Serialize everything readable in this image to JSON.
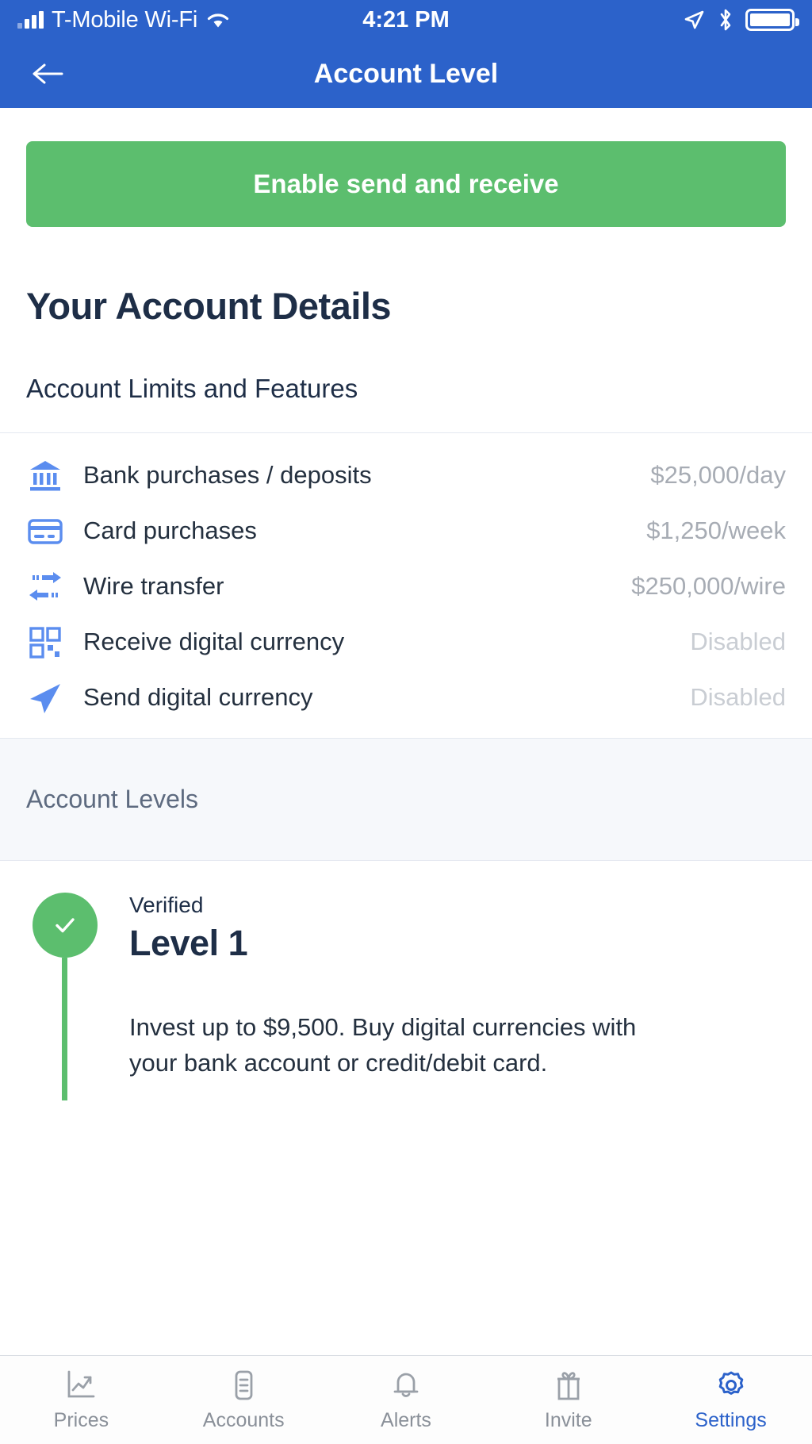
{
  "status_bar": {
    "carrier": "T-Mobile Wi-Fi",
    "time": "4:21 PM",
    "icons": [
      "signal-bars-icon",
      "wifi-icon",
      "location-arrow-icon",
      "bluetooth-icon",
      "battery-icon"
    ]
  },
  "header": {
    "title": "Account Level",
    "back_icon": "back-arrow-icon",
    "background_color": "#2C62CA"
  },
  "cta": {
    "label": "Enable send and receive",
    "color": "#5CBE6E"
  },
  "page_title": "Your Account Details",
  "limits_section": {
    "title": "Account Limits and Features",
    "rows": [
      {
        "icon": "bank-icon",
        "label": "Bank purchases / deposits",
        "value": "$25,000/day",
        "disabled": false
      },
      {
        "icon": "credit-card-icon",
        "label": "Card purchases",
        "value": "$1,250/week",
        "disabled": false
      },
      {
        "icon": "wire-transfer-icon",
        "label": "Wire transfer",
        "value": "$250,000/wire",
        "disabled": false
      },
      {
        "icon": "qr-code-icon",
        "label": "Receive digital currency",
        "value": "Disabled",
        "disabled": true
      },
      {
        "icon": "send-plane-icon",
        "label": "Send digital currency",
        "value": "Disabled",
        "disabled": true
      }
    ]
  },
  "levels_section": {
    "title": "Account Levels",
    "levels": [
      {
        "status": "Verified",
        "name": "Level 1",
        "description": "Invest up to $9,500. Buy digital currencies with your bank account or credit/debit card.",
        "marker_icon": "check-icon",
        "marker_color": "#5CBE6E"
      }
    ]
  },
  "tabbar": {
    "active_color": "#2C62CA",
    "items": [
      {
        "label": "Prices",
        "icon": "chart-line-icon",
        "active": false
      },
      {
        "label": "Accounts",
        "icon": "document-icon",
        "active": false
      },
      {
        "label": "Alerts",
        "icon": "bell-icon",
        "active": false
      },
      {
        "label": "Invite",
        "icon": "gift-icon",
        "active": false
      },
      {
        "label": "Settings",
        "icon": "gear-icon",
        "active": true
      }
    ]
  }
}
